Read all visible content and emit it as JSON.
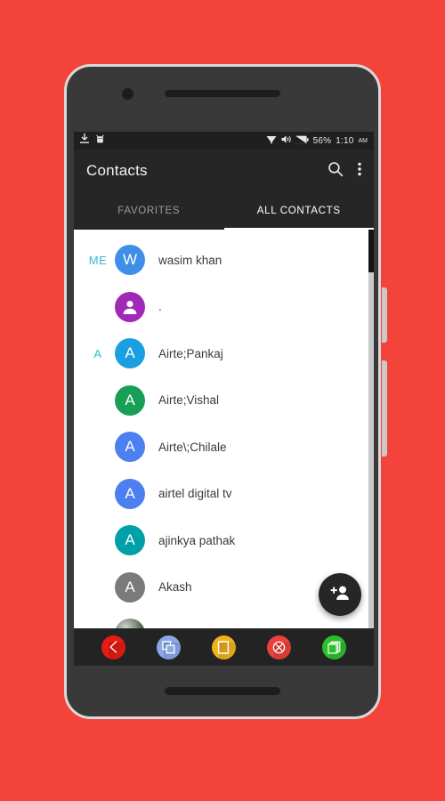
{
  "background": {
    "color": "#f4433a"
  },
  "statusbar": {
    "left_icons": [
      {
        "name": "download-icon"
      },
      {
        "name": "android-app-icon"
      }
    ],
    "right_icons": [
      {
        "name": "wifi-icon"
      },
      {
        "name": "volume-icon"
      },
      {
        "name": "battery-icon"
      }
    ],
    "battery_percent": "56%",
    "time": "1:10",
    "ampm": "AM"
  },
  "appbar": {
    "title": "Contacts",
    "search_icon": "search-icon",
    "overflow_icon": "more-vert-icon"
  },
  "tabs": [
    {
      "label": "FAVORITES",
      "active": false
    },
    {
      "label": "ALL CONTACTS",
      "active": true
    }
  ],
  "contacts": [
    {
      "section": "ME",
      "name": "wasim khan",
      "initial": "W",
      "color": "#3f8ee8",
      "type": "initial"
    },
    {
      "section": "",
      "name": ".",
      "initial": "",
      "color": "#a229b8",
      "type": "person"
    },
    {
      "section": "A",
      "name": "Airte;Pankaj",
      "initial": "A",
      "color": "#1aa0e0",
      "type": "initial"
    },
    {
      "section": "",
      "name": "Airte;Vishal",
      "initial": "A",
      "color": "#17a055",
      "type": "initial"
    },
    {
      "section": "",
      "name": "Airte\\;Chilale",
      "initial": "A",
      "color": "#4c7ff0",
      "type": "initial"
    },
    {
      "section": "",
      "name": "airtel digital tv",
      "initial": "A",
      "color": "#4c7ff0",
      "type": "initial"
    },
    {
      "section": "",
      "name": "ajinkya pathak",
      "initial": "A",
      "color": "#00a0a8",
      "type": "initial"
    },
    {
      "section": "",
      "name": "Akash",
      "initial": "A",
      "color": "#7a7a7a",
      "type": "initial"
    },
    {
      "section": "",
      "name": "",
      "initial": "",
      "color": "#5c6b52",
      "type": "photo"
    }
  ],
  "fab": {
    "icon": "add-person-icon"
  },
  "navbar": {
    "buttons": [
      {
        "name": "back-button",
        "icon": "chevron-left-icon",
        "color": "#e81b13"
      },
      {
        "name": "recents-button",
        "icon": "copy-windows-icon",
        "color": "#8aa8e8"
      },
      {
        "name": "home-button",
        "icon": "rounded-square-icon",
        "color": "#f2b21c"
      },
      {
        "name": "close-button",
        "icon": "x-circle-icon",
        "color": "#e8423a"
      },
      {
        "name": "multiwindow-button",
        "icon": "stacked-windows-icon",
        "color": "#2cbf2c"
      }
    ]
  }
}
